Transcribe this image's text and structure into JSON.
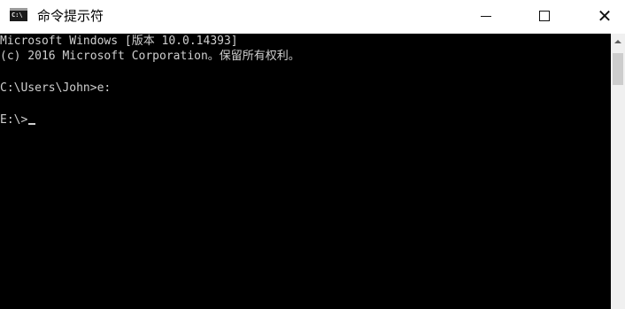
{
  "window": {
    "title": "命令提示符",
    "icon_text": "C:\\",
    "controls": {
      "minimize": "minimize",
      "maximize": "maximize",
      "close": "✕"
    }
  },
  "console": {
    "lines": [
      "Microsoft Windows [版本 10.0.14393]",
      "(c) 2016 Microsoft Corporation。保留所有权利。",
      "C:\\Users\\John>e:",
      "E:\\>"
    ],
    "background": "#000000",
    "text_color": "#cfcfcf"
  },
  "scrollbar": {
    "track_color": "#f0f0f0",
    "thumb_color": "#cdcdcd"
  }
}
